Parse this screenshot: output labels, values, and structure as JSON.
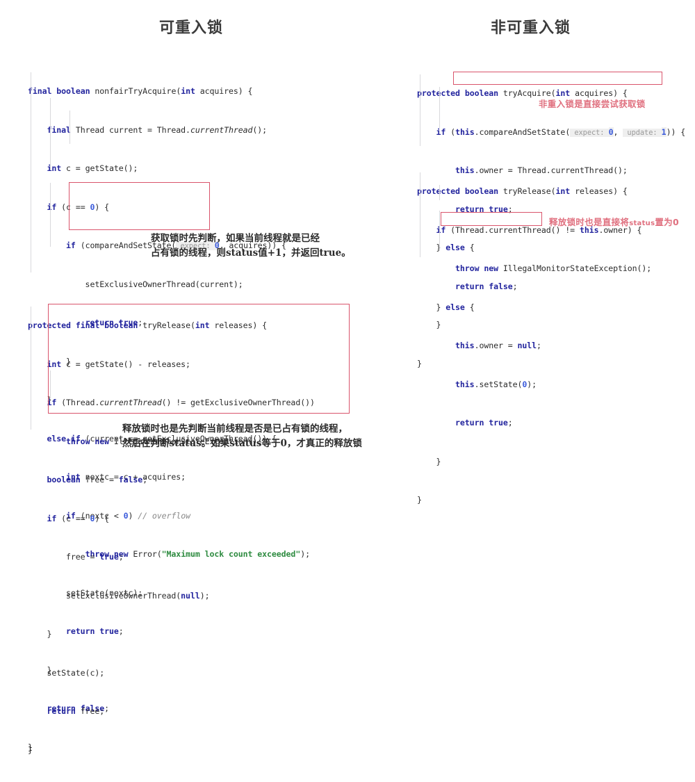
{
  "titles": {
    "left": "可重入锁",
    "right": "非可重入锁"
  },
  "left_column": {
    "block1": {
      "name": "nonfairTryAcquire",
      "lines": [
        "final boolean nonfairTryAcquire(int acquires) {",
        "    final Thread current = Thread.currentThread();",
        "    int c = getState();",
        "    if (c == 0) {",
        "        if (compareAndSetState( expect: 0, acquires)) {",
        "            setExclusiveOwnerThread(current);",
        "            return true;",
        "        }",
        "    }",
        "    else if (current == getExclusiveOwnerThread()) {",
        "        int nextc = c + acquires;",
        "        if (nextc < 0) // overflow",
        "            throw new Error(\"Maximum lock count exceeded\");",
        "        setState(nextc);",
        "        return true;",
        "    }",
        "    return false;",
        "}"
      ],
      "annotation": "获取锁时先判断，如果当前线程就是已经\n占有锁的线程，则status值+1，并返回true。"
    },
    "block2": {
      "name": "tryRelease",
      "lines": [
        "protected final boolean tryRelease(int releases) {",
        "    int c = getState() - releases;",
        "    if (Thread.currentThread() != getExclusiveOwnerThread())",
        "        throw new IllegalMonitorStateException();",
        "    boolean free = false;",
        "    if (c == 0) {",
        "        free = true;",
        "        setExclusiveOwnerThread(null);",
        "    }",
        "    setState(c);",
        "    return free;",
        "}"
      ],
      "annotation": "释放锁时也是先判断当前线程是否是已占有锁的线程，\n然后在判断status。如果status等于0，才真正的释放锁"
    }
  },
  "right_column": {
    "block1": {
      "name": "tryAcquire",
      "lines": [
        "protected boolean tryAcquire(int acquires) {",
        "    if (this.compareAndSetState( expect: 0,  update: 1)) {",
        "        this.owner = Thread.currentThread();",
        "        return true;",
        "    } else {",
        "        return false;",
        "    }",
        "}"
      ],
      "annotation": "非重入锁是直接尝试获取锁"
    },
    "block2": {
      "name": "tryRelease",
      "lines": [
        "protected boolean tryRelease(int releases) {",
        "    if (Thread.currentThread() != this.owner) {",
        "        throw new IllegalMonitorStateException();",
        "    } else {",
        "        this.owner = null;",
        "        this.setState(0);",
        "        return true;",
        "    }",
        "}"
      ],
      "annotation_prefix": "释放锁时也是直接将",
      "annotation_mid": "status",
      "annotation_suffix": "置为0"
    }
  },
  "colors": {
    "keyword": "#23259e",
    "string": "#2e8b40",
    "number": "#3b5bdb",
    "comment": "#8a8a8a",
    "highlight_box": "#d9546b",
    "annotation_red": "#e0707f",
    "title": "#3b3b3b"
  }
}
